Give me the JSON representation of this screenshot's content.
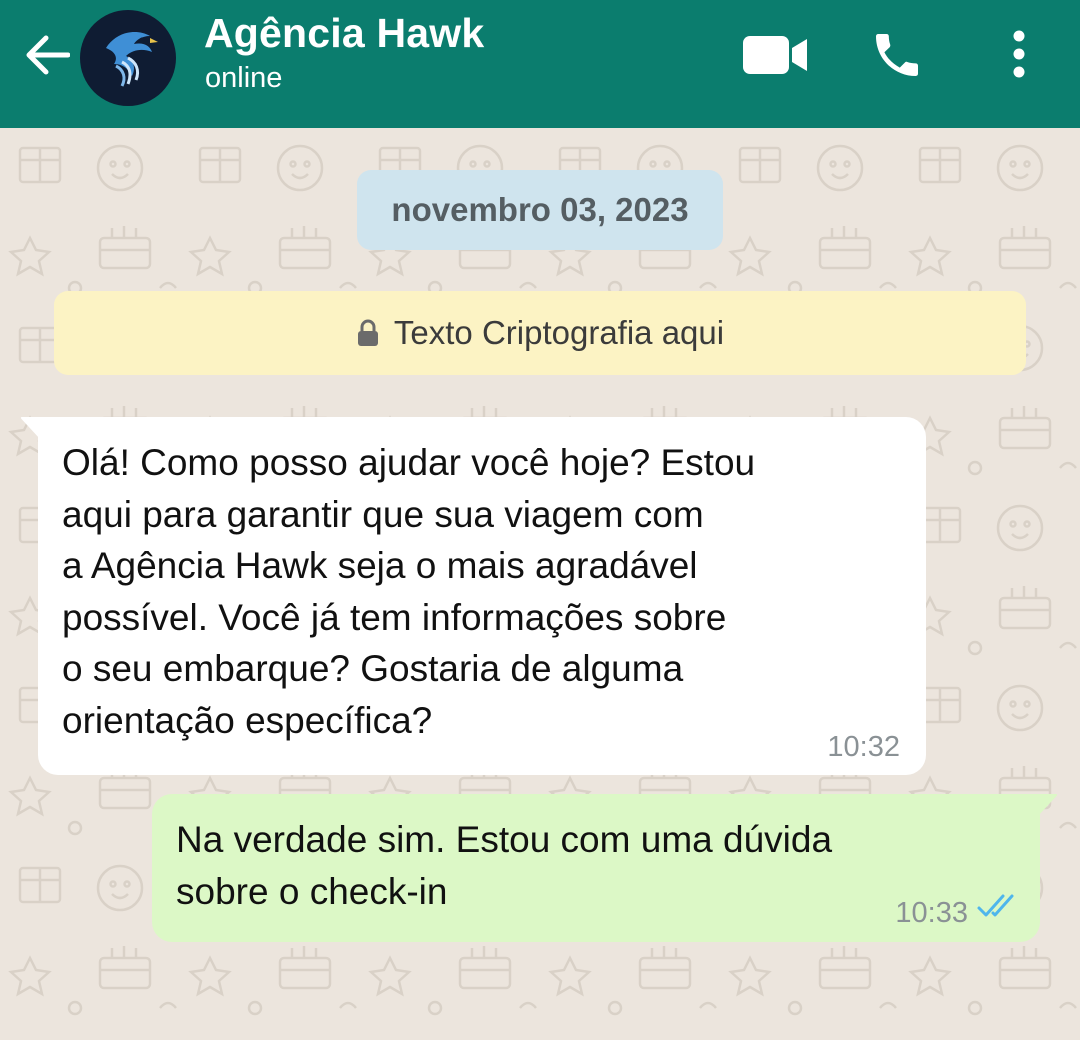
{
  "header": {
    "contact_name": "Agência Hawk",
    "status": "online",
    "icons": [
      "back-arrow-icon",
      "video-call-icon",
      "phone-call-icon",
      "more-options-icon"
    ],
    "background_color": "#0B7D6E"
  },
  "chat": {
    "date_label": "novembro 03, 2023",
    "encryption_notice": "Texto Criptografia aqui",
    "messages": [
      {
        "direction": "incoming",
        "text": "Olá! Como posso ajudar você hoje? Estou\naqui para garantir que sua viagem com\na Agência Hawk seja o mais agradável\npossível. Você já tem informações sobre\no seu embarque? Gostaria de alguma\norientação específica?",
        "time": "10:32"
      },
      {
        "direction": "outgoing",
        "text": "Na verdade sim. Estou com uma dúvida\nsobre o check-in",
        "time": "10:33",
        "status": "read"
      }
    ]
  },
  "colors": {
    "chat_background": "#ECE5DD",
    "incoming_bubble": "#FFFFFF",
    "outgoing_bubble": "#DCF8C6",
    "date_pill": "#CFE4EE",
    "encryption_notice": "#FCF3C4",
    "read_ticks": "#4FB6EC"
  }
}
